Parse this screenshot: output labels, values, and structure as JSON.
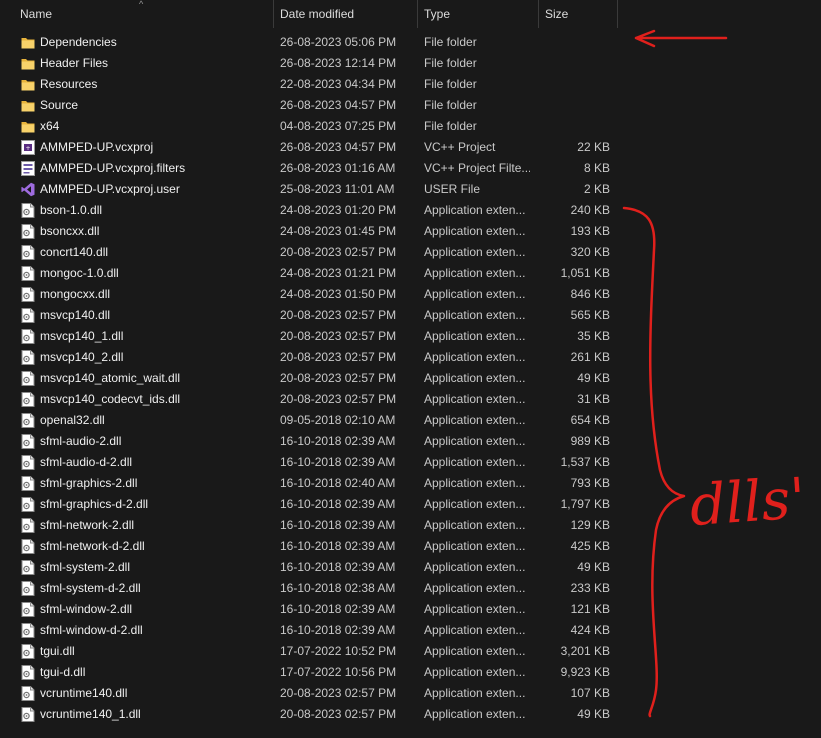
{
  "header": {
    "name": "Name",
    "date_modified": "Date modified",
    "type": "Type",
    "size": "Size"
  },
  "annotations": {
    "brace_label": "dlls'",
    "arrow_color": "#e0201c"
  },
  "files": [
    {
      "name": "Dependencies",
      "date": "26-08-2023 05:06 PM",
      "type": "File folder",
      "size": "",
      "icon": "folder-icon"
    },
    {
      "name": "Header Files",
      "date": "26-08-2023 12:14 PM",
      "type": "File folder",
      "size": "",
      "icon": "folder-icon"
    },
    {
      "name": "Resources",
      "date": "22-08-2023 04:34 PM",
      "type": "File folder",
      "size": "",
      "icon": "folder-icon"
    },
    {
      "name": "Source",
      "date": "26-08-2023 04:57 PM",
      "type": "File folder",
      "size": "",
      "icon": "folder-icon"
    },
    {
      "name": "x64",
      "date": "04-08-2023 07:25 PM",
      "type": "File folder",
      "size": "",
      "icon": "folder-icon"
    },
    {
      "name": "AMMPED-UP.vcxproj",
      "date": "26-08-2023 04:57 PM",
      "type": "VC++ Project",
      "size": "22 KB",
      "icon": "vcxproj-icon"
    },
    {
      "name": "AMMPED-UP.vcxproj.filters",
      "date": "26-08-2023 01:16 AM",
      "type": "VC++ Project Filte...",
      "size": "8 KB",
      "icon": "filters-icon"
    },
    {
      "name": "AMMPED-UP.vcxproj.user",
      "date": "25-08-2023 11:01 AM",
      "type": "USER File",
      "size": "2 KB",
      "icon": "visual-studio-icon"
    },
    {
      "name": "bson-1.0.dll",
      "date": "24-08-2023 01:20 PM",
      "type": "Application exten...",
      "size": "240 KB",
      "icon": "dll-icon"
    },
    {
      "name": "bsoncxx.dll",
      "date": "24-08-2023 01:45 PM",
      "type": "Application exten...",
      "size": "193 KB",
      "icon": "dll-icon"
    },
    {
      "name": "concrt140.dll",
      "date": "20-08-2023 02:57 PM",
      "type": "Application exten...",
      "size": "320 KB",
      "icon": "dll-icon"
    },
    {
      "name": "mongoc-1.0.dll",
      "date": "24-08-2023 01:21 PM",
      "type": "Application exten...",
      "size": "1,051 KB",
      "icon": "dll-icon"
    },
    {
      "name": "mongocxx.dll",
      "date": "24-08-2023 01:50 PM",
      "type": "Application exten...",
      "size": "846 KB",
      "icon": "dll-icon"
    },
    {
      "name": "msvcp140.dll",
      "date": "20-08-2023 02:57 PM",
      "type": "Application exten...",
      "size": "565 KB",
      "icon": "dll-icon"
    },
    {
      "name": "msvcp140_1.dll",
      "date": "20-08-2023 02:57 PM",
      "type": "Application exten...",
      "size": "35 KB",
      "icon": "dll-icon"
    },
    {
      "name": "msvcp140_2.dll",
      "date": "20-08-2023 02:57 PM",
      "type": "Application exten...",
      "size": "261 KB",
      "icon": "dll-icon"
    },
    {
      "name": "msvcp140_atomic_wait.dll",
      "date": "20-08-2023 02:57 PM",
      "type": "Application exten...",
      "size": "49 KB",
      "icon": "dll-icon"
    },
    {
      "name": "msvcp140_codecvt_ids.dll",
      "date": "20-08-2023 02:57 PM",
      "type": "Application exten...",
      "size": "31 KB",
      "icon": "dll-icon"
    },
    {
      "name": "openal32.dll",
      "date": "09-05-2018 02:10 AM",
      "type": "Application exten...",
      "size": "654 KB",
      "icon": "dll-icon"
    },
    {
      "name": "sfml-audio-2.dll",
      "date": "16-10-2018 02:39 AM",
      "type": "Application exten...",
      "size": "989 KB",
      "icon": "dll-icon"
    },
    {
      "name": "sfml-audio-d-2.dll",
      "date": "16-10-2018 02:39 AM",
      "type": "Application exten...",
      "size": "1,537 KB",
      "icon": "dll-icon"
    },
    {
      "name": "sfml-graphics-2.dll",
      "date": "16-10-2018 02:40 AM",
      "type": "Application exten...",
      "size": "793 KB",
      "icon": "dll-icon"
    },
    {
      "name": "sfml-graphics-d-2.dll",
      "date": "16-10-2018 02:39 AM",
      "type": "Application exten...",
      "size": "1,797 KB",
      "icon": "dll-icon"
    },
    {
      "name": "sfml-network-2.dll",
      "date": "16-10-2018 02:39 AM",
      "type": "Application exten...",
      "size": "129 KB",
      "icon": "dll-icon"
    },
    {
      "name": "sfml-network-d-2.dll",
      "date": "16-10-2018 02:39 AM",
      "type": "Application exten...",
      "size": "425 KB",
      "icon": "dll-icon"
    },
    {
      "name": "sfml-system-2.dll",
      "date": "16-10-2018 02:39 AM",
      "type": "Application exten...",
      "size": "49 KB",
      "icon": "dll-icon"
    },
    {
      "name": "sfml-system-d-2.dll",
      "date": "16-10-2018 02:38 AM",
      "type": "Application exten...",
      "size": "233 KB",
      "icon": "dll-icon"
    },
    {
      "name": "sfml-window-2.dll",
      "date": "16-10-2018 02:39 AM",
      "type": "Application exten...",
      "size": "121 KB",
      "icon": "dll-icon"
    },
    {
      "name": "sfml-window-d-2.dll",
      "date": "16-10-2018 02:39 AM",
      "type": "Application exten...",
      "size": "424 KB",
      "icon": "dll-icon"
    },
    {
      "name": "tgui.dll",
      "date": "17-07-2022 10:52 PM",
      "type": "Application exten...",
      "size": "3,201 KB",
      "icon": "dll-icon"
    },
    {
      "name": "tgui-d.dll",
      "date": "17-07-2022 10:56 PM",
      "type": "Application exten...",
      "size": "9,923 KB",
      "icon": "dll-icon"
    },
    {
      "name": "vcruntime140.dll",
      "date": "20-08-2023 02:57 PM",
      "type": "Application exten...",
      "size": "107 KB",
      "icon": "dll-icon"
    },
    {
      "name": "vcruntime140_1.dll",
      "date": "20-08-2023 02:57 PM",
      "type": "Application exten...",
      "size": "49 KB",
      "icon": "dll-icon"
    }
  ]
}
